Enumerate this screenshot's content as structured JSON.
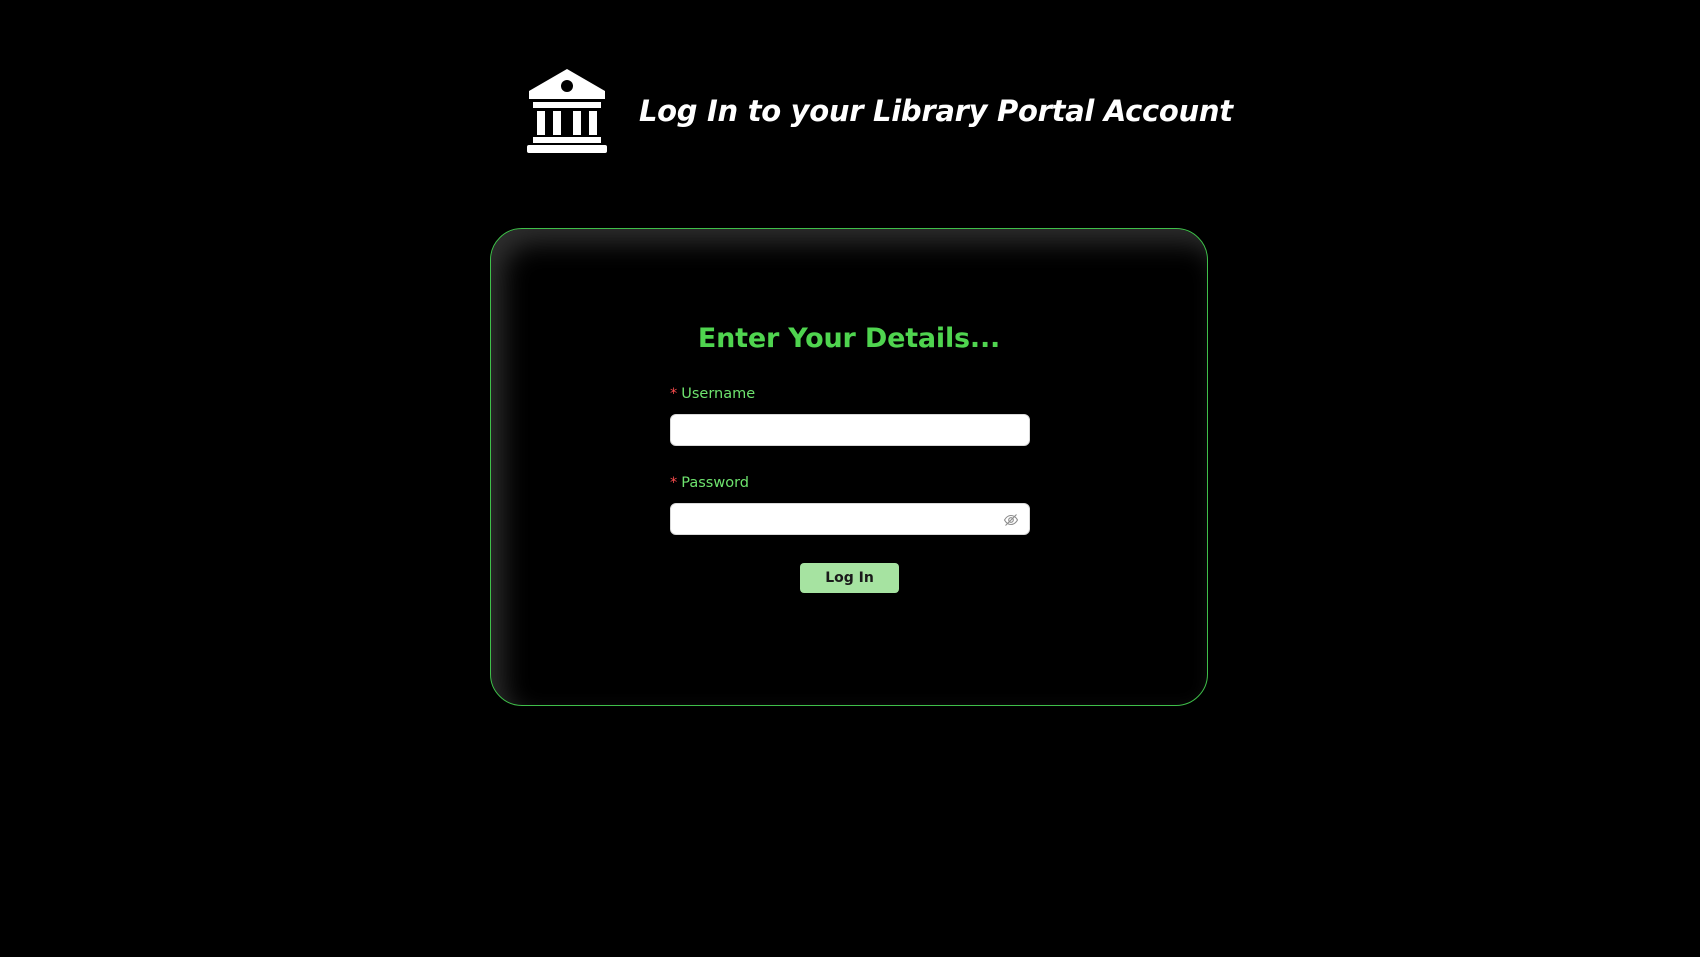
{
  "header": {
    "icon": "bank-icon",
    "title": "Log In to your Library Portal Account"
  },
  "form": {
    "heading": "Enter Your Details...",
    "required_marker": "*",
    "username": {
      "label": "Username",
      "value": "",
      "placeholder": ""
    },
    "password": {
      "label": "Password",
      "value": "",
      "placeholder": "",
      "toggle_icon": "eye-invisible-icon"
    },
    "submit_label": "Log In"
  },
  "colors": {
    "background": "#000000",
    "accent": "#4fd44f",
    "label": "#6ee36e",
    "required": "#ff4d4f",
    "button": "#a6e3a1",
    "card_border": "#3fbf4a"
  }
}
